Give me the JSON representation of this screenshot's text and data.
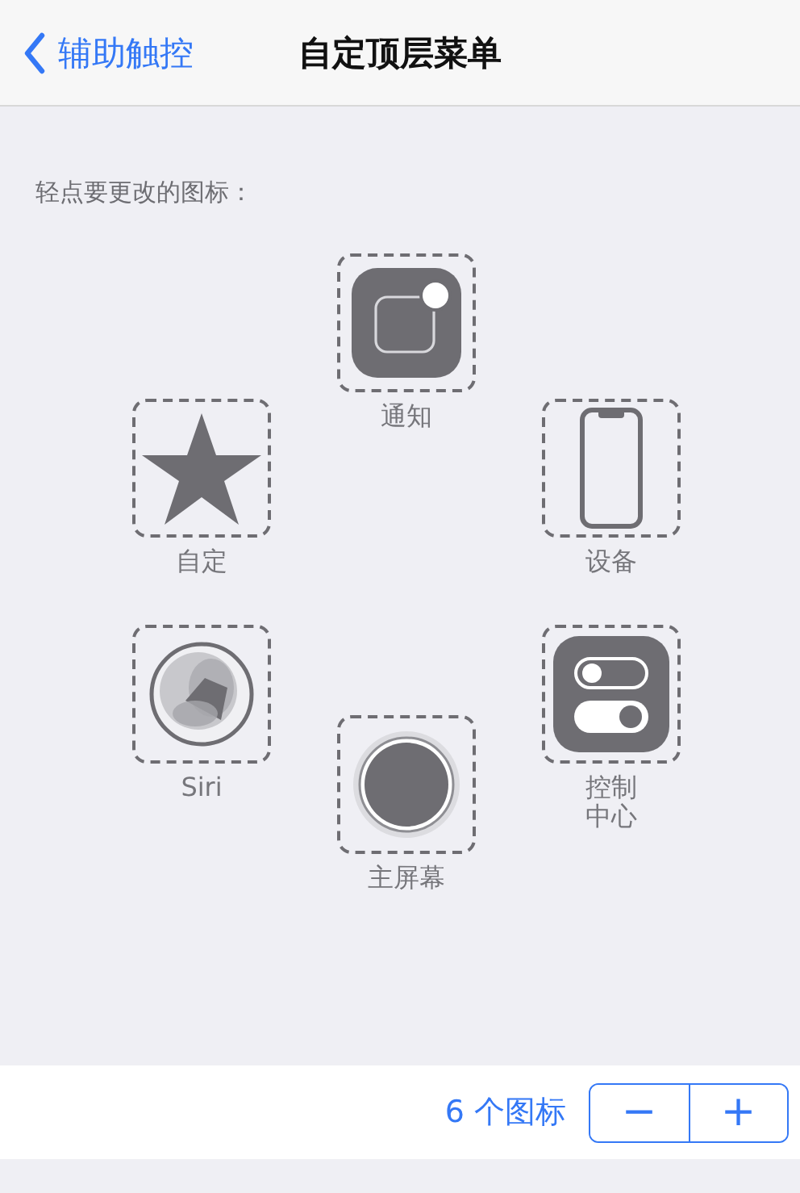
{
  "nav": {
    "back": "辅助触控",
    "title": "自定顶层菜单"
  },
  "hint": "轻点要更改的图标：",
  "slots": [
    {
      "kind": "notification",
      "label": "通知"
    },
    {
      "kind": "device",
      "label": "设备"
    },
    {
      "kind": "control",
      "label": "控制中心"
    },
    {
      "kind": "home",
      "label": "主屏幕"
    },
    {
      "kind": "siri",
      "label": "Siri"
    },
    {
      "kind": "star",
      "label": "自定"
    }
  ],
  "footer": {
    "count": "6 个图标",
    "minus": "−",
    "plus": "+"
  }
}
